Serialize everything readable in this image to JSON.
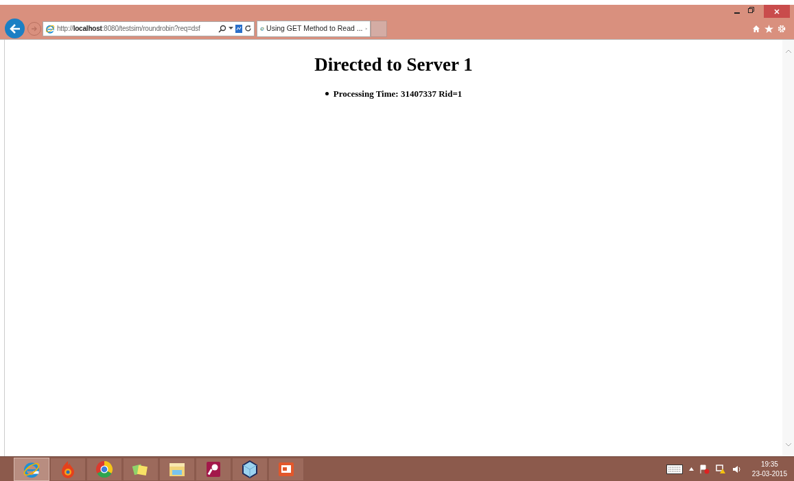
{
  "browser": {
    "url": "http://**localhost**:8080/testsim/roundrobin?req=dsf",
    "tabs": [
      {
        "title": "Using GET Method to Read ...",
        "selected": true
      }
    ]
  },
  "page": {
    "heading": "Directed to Server 1",
    "items": [
      "Processing Time: 31407337 Rid=1"
    ]
  },
  "taskbar": {
    "apps": [
      {
        "kind": "ie",
        "selected": true
      },
      {
        "kind": "flame",
        "selected": false
      },
      {
        "kind": "chrome",
        "selected": false
      },
      {
        "kind": "notes",
        "selected": false
      },
      {
        "kind": "folder",
        "selected": false
      },
      {
        "kind": "key",
        "selected": false
      },
      {
        "kind": "cube",
        "selected": false
      },
      {
        "kind": "slides",
        "selected": false
      }
    ],
    "time": "19:35",
    "date": "23-03-2015"
  }
}
